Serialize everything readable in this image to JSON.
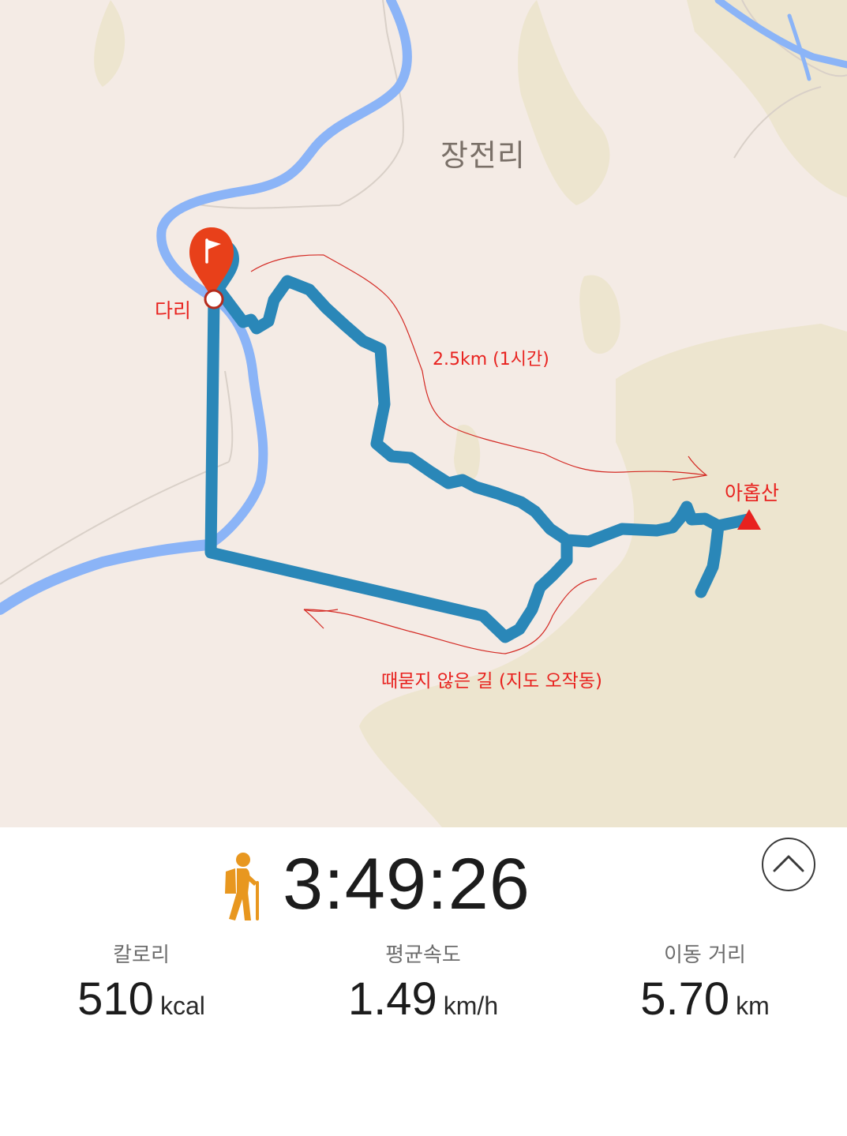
{
  "map": {
    "place_label": "장전리",
    "annotations": {
      "start": "다리",
      "distance": "2.5km (1시간)",
      "peak": "아홉산",
      "unmarked_path": "때묻지 않은 길 (지도 오작동)"
    },
    "colors": {
      "route": "#2a87b8",
      "river": "#8bb4f7",
      "annotation": "#e8221f",
      "start_marker": "#e8401a",
      "terrain": "#ede5cf",
      "land": "#f4ebe5"
    },
    "icons": {
      "start_marker": "flag-pin-icon",
      "peak": "triangle-icon"
    }
  },
  "workout": {
    "activity_icon": "hiker-icon",
    "duration": "3:49:26",
    "collapse_icon": "chevron-up-icon",
    "stats": [
      {
        "label": "칼로리",
        "value": "510",
        "unit": "kcal"
      },
      {
        "label": "평균속도",
        "value": "1.49",
        "unit": "km/h"
      },
      {
        "label": "이동 거리",
        "value": "5.70",
        "unit": "km"
      }
    ]
  }
}
